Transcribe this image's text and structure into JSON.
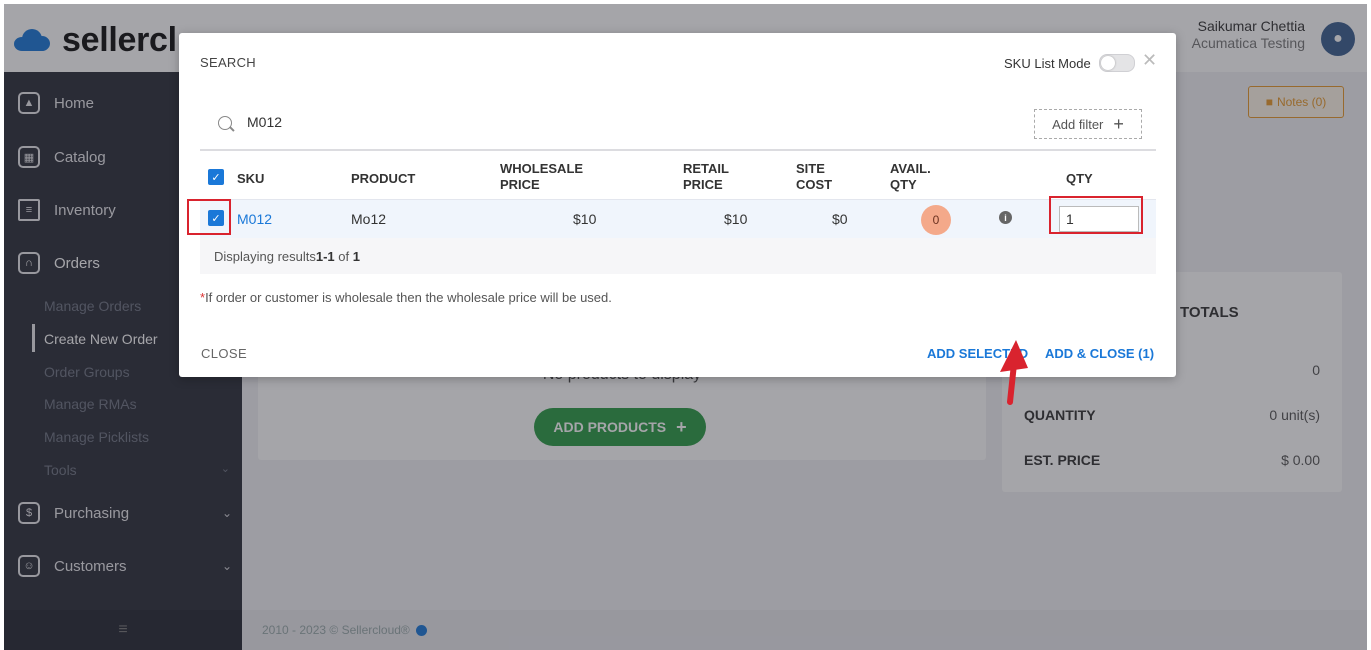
{
  "header": {
    "brand": "sellercl",
    "user_name": "Saikumar Chettia",
    "company": "Acumatica Testing"
  },
  "sidebar": {
    "items": [
      {
        "label": "Home",
        "icon": "home-icon"
      },
      {
        "label": "Catalog",
        "icon": "catalog-icon"
      },
      {
        "label": "Inventory",
        "icon": "inventory-icon"
      },
      {
        "label": "Orders",
        "icon": "orders-icon"
      },
      {
        "label": "Purchasing",
        "icon": "purchasing-icon"
      },
      {
        "label": "Customers",
        "icon": "customers-icon"
      }
    ],
    "orders_sub": [
      "Manage Orders",
      "Create New Order",
      "Order Groups",
      "Manage RMAs",
      "Manage Picklists",
      "Tools"
    ],
    "active_sub": "Create New Order"
  },
  "main": {
    "notes_label": "Notes (0)",
    "no_products": "No products to display",
    "add_products": "ADD PRODUCTS",
    "totals_title": "TOTALS",
    "totals": [
      {
        "label": "",
        "value": "0"
      },
      {
        "label": "QUANTITY",
        "value": "0 unit(s)"
      },
      {
        "label": "EST. PRICE",
        "value": "$ 0.00"
      }
    ]
  },
  "footer": {
    "text": "2010 - 2023 © Sellercloud®"
  },
  "modal": {
    "title": "SEARCH",
    "sku_list_mode": "SKU List Mode",
    "search_value": "M012",
    "add_filter": "Add filter",
    "columns": {
      "sku": "SKU",
      "product": "PRODUCT",
      "wholesale_1": "WHOLESALE",
      "wholesale_2": "PRICE",
      "retail_1": "RETAIL",
      "retail_2": "PRICE",
      "site_1": "SITE",
      "site_2": "COST",
      "avail_1": "AVAIL.",
      "avail_2": "QTY",
      "qty": "QTY"
    },
    "row": {
      "sku": "M012",
      "product": "Mo12",
      "wholesale_price": "$10",
      "retail_price": "$10",
      "site_cost": "$0",
      "avail_qty": "0",
      "qty": "1"
    },
    "results_prefix": "Displaying results ",
    "results_range": "1-1",
    "results_of": " of ",
    "results_total": "1",
    "note_star": "*",
    "note_text": "If order or customer is wholesale then the wholesale price will be used.",
    "close_label": "CLOSE",
    "add_selected": "ADD SELECTED",
    "add_close": "ADD & CLOSE (1)"
  },
  "colors": {
    "accent": "#1a78d8",
    "highlight": "#d9232e",
    "badge": "#f4a98a",
    "add_products": "#2c9b45",
    "notes": "#e89a2b"
  }
}
